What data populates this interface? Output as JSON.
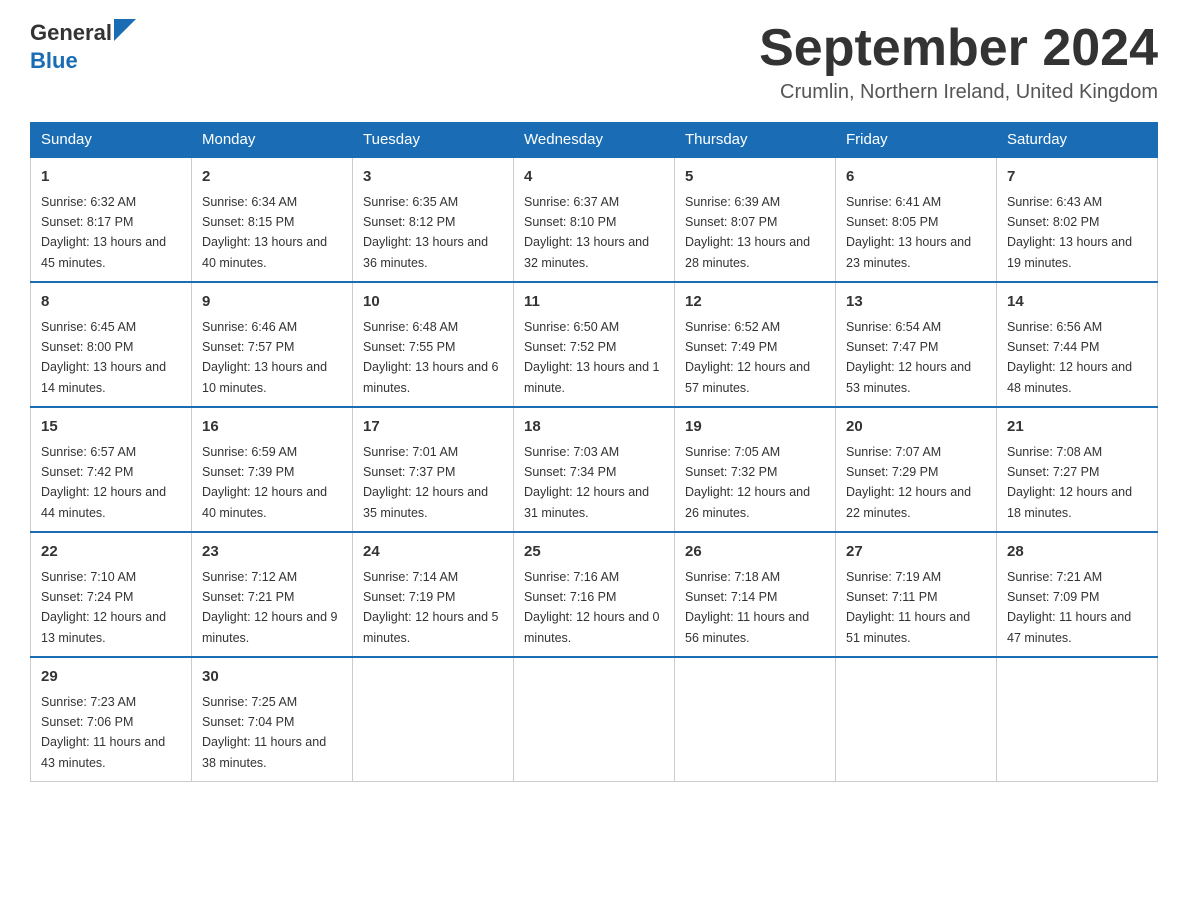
{
  "header": {
    "title": "September 2024",
    "subtitle": "Crumlin, Northern Ireland, United Kingdom",
    "logo_general": "General",
    "logo_blue": "Blue"
  },
  "days_of_week": [
    "Sunday",
    "Monday",
    "Tuesday",
    "Wednesday",
    "Thursday",
    "Friday",
    "Saturday"
  ],
  "weeks": [
    [
      {
        "day": "1",
        "sunrise": "6:32 AM",
        "sunset": "8:17 PM",
        "daylight": "13 hours and 45 minutes."
      },
      {
        "day": "2",
        "sunrise": "6:34 AM",
        "sunset": "8:15 PM",
        "daylight": "13 hours and 40 minutes."
      },
      {
        "day": "3",
        "sunrise": "6:35 AM",
        "sunset": "8:12 PM",
        "daylight": "13 hours and 36 minutes."
      },
      {
        "day": "4",
        "sunrise": "6:37 AM",
        "sunset": "8:10 PM",
        "daylight": "13 hours and 32 minutes."
      },
      {
        "day": "5",
        "sunrise": "6:39 AM",
        "sunset": "8:07 PM",
        "daylight": "13 hours and 28 minutes."
      },
      {
        "day": "6",
        "sunrise": "6:41 AM",
        "sunset": "8:05 PM",
        "daylight": "13 hours and 23 minutes."
      },
      {
        "day": "7",
        "sunrise": "6:43 AM",
        "sunset": "8:02 PM",
        "daylight": "13 hours and 19 minutes."
      }
    ],
    [
      {
        "day": "8",
        "sunrise": "6:45 AM",
        "sunset": "8:00 PM",
        "daylight": "13 hours and 14 minutes."
      },
      {
        "day": "9",
        "sunrise": "6:46 AM",
        "sunset": "7:57 PM",
        "daylight": "13 hours and 10 minutes."
      },
      {
        "day": "10",
        "sunrise": "6:48 AM",
        "sunset": "7:55 PM",
        "daylight": "13 hours and 6 minutes."
      },
      {
        "day": "11",
        "sunrise": "6:50 AM",
        "sunset": "7:52 PM",
        "daylight": "13 hours and 1 minute."
      },
      {
        "day": "12",
        "sunrise": "6:52 AM",
        "sunset": "7:49 PM",
        "daylight": "12 hours and 57 minutes."
      },
      {
        "day": "13",
        "sunrise": "6:54 AM",
        "sunset": "7:47 PM",
        "daylight": "12 hours and 53 minutes."
      },
      {
        "day": "14",
        "sunrise": "6:56 AM",
        "sunset": "7:44 PM",
        "daylight": "12 hours and 48 minutes."
      }
    ],
    [
      {
        "day": "15",
        "sunrise": "6:57 AM",
        "sunset": "7:42 PM",
        "daylight": "12 hours and 44 minutes."
      },
      {
        "day": "16",
        "sunrise": "6:59 AM",
        "sunset": "7:39 PM",
        "daylight": "12 hours and 40 minutes."
      },
      {
        "day": "17",
        "sunrise": "7:01 AM",
        "sunset": "7:37 PM",
        "daylight": "12 hours and 35 minutes."
      },
      {
        "day": "18",
        "sunrise": "7:03 AM",
        "sunset": "7:34 PM",
        "daylight": "12 hours and 31 minutes."
      },
      {
        "day": "19",
        "sunrise": "7:05 AM",
        "sunset": "7:32 PM",
        "daylight": "12 hours and 26 minutes."
      },
      {
        "day": "20",
        "sunrise": "7:07 AM",
        "sunset": "7:29 PM",
        "daylight": "12 hours and 22 minutes."
      },
      {
        "day": "21",
        "sunrise": "7:08 AM",
        "sunset": "7:27 PM",
        "daylight": "12 hours and 18 minutes."
      }
    ],
    [
      {
        "day": "22",
        "sunrise": "7:10 AM",
        "sunset": "7:24 PM",
        "daylight": "12 hours and 13 minutes."
      },
      {
        "day": "23",
        "sunrise": "7:12 AM",
        "sunset": "7:21 PM",
        "daylight": "12 hours and 9 minutes."
      },
      {
        "day": "24",
        "sunrise": "7:14 AM",
        "sunset": "7:19 PM",
        "daylight": "12 hours and 5 minutes."
      },
      {
        "day": "25",
        "sunrise": "7:16 AM",
        "sunset": "7:16 PM",
        "daylight": "12 hours and 0 minutes."
      },
      {
        "day": "26",
        "sunrise": "7:18 AM",
        "sunset": "7:14 PM",
        "daylight": "11 hours and 56 minutes."
      },
      {
        "day": "27",
        "sunrise": "7:19 AM",
        "sunset": "7:11 PM",
        "daylight": "11 hours and 51 minutes."
      },
      {
        "day": "28",
        "sunrise": "7:21 AM",
        "sunset": "7:09 PM",
        "daylight": "11 hours and 47 minutes."
      }
    ],
    [
      {
        "day": "29",
        "sunrise": "7:23 AM",
        "sunset": "7:06 PM",
        "daylight": "11 hours and 43 minutes."
      },
      {
        "day": "30",
        "sunrise": "7:25 AM",
        "sunset": "7:04 PM",
        "daylight": "11 hours and 38 minutes."
      },
      null,
      null,
      null,
      null,
      null
    ]
  ],
  "labels": {
    "sunrise": "Sunrise:",
    "sunset": "Sunset:",
    "daylight": "Daylight:"
  },
  "accent_color": "#1a6db5"
}
